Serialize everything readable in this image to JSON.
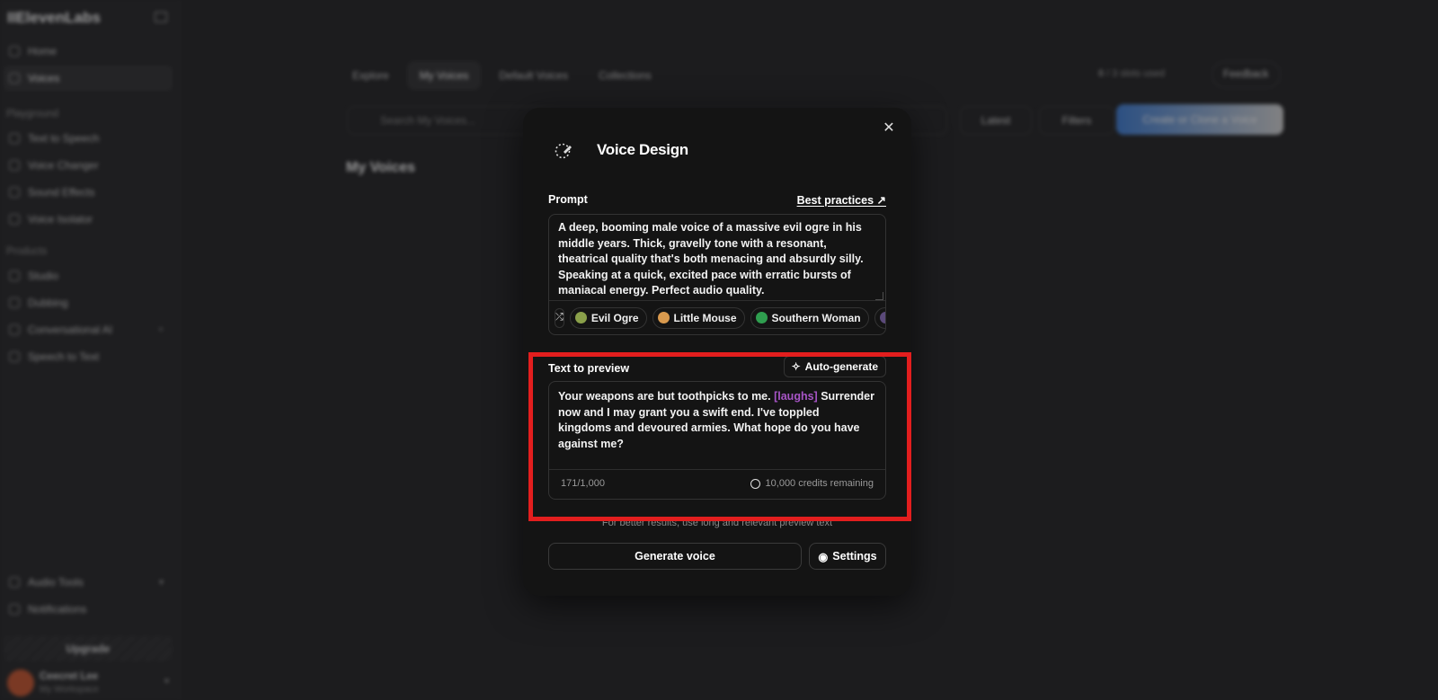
{
  "app": {
    "logo": "IIElevenLabs"
  },
  "sidebar": {
    "items": [
      {
        "label": "Home"
      },
      {
        "label": "Voices"
      },
      {
        "label": "Text to Speech"
      },
      {
        "label": "Voice Changer"
      },
      {
        "label": "Sound Effects"
      },
      {
        "label": "Voice Isolator"
      },
      {
        "label": "Studio"
      },
      {
        "label": "Dubbing"
      },
      {
        "label": "Conversational AI"
      },
      {
        "label": "Speech to Text"
      },
      {
        "label": "Audio Tools"
      },
      {
        "label": "Notifications"
      }
    ],
    "sections": {
      "playground": "Playground",
      "products": "Products"
    },
    "upgrade": "Upgrade",
    "user": {
      "name": "Ceecret Lee",
      "workspace": "My Workspace"
    }
  },
  "topnav": {
    "tabs": [
      "Explore",
      "My Voices",
      "Default Voices",
      "Collections"
    ],
    "slots_count": "0",
    "slots_text": "/ 3 slots used",
    "feedback": "Feedback"
  },
  "toolbar": {
    "search_placeholder": "Search My Voices...",
    "latest": "Latest",
    "filters": "Filters",
    "create": "Create or Clone a Voice"
  },
  "page": {
    "heading": "My Voices"
  },
  "modal": {
    "title": "Voice Design",
    "prompt_label": "Prompt",
    "best_practices": "Best practices ↗",
    "prompt_text": "A deep, booming male voice of a massive evil ogre in his middle years. Thick, gravelly tone with a resonant, theatrical quality that's both menacing and absurdly silly. Speaking at a quick, excited pace with erratic bursts of maniacal energy. Perfect audio quality.",
    "chips": [
      {
        "label": "Evil Ogre",
        "color": "#8aa04a"
      },
      {
        "label": "Little Mouse",
        "color": "#d99a4e"
      },
      {
        "label": "Southern Woman",
        "color": "#2f9e4f"
      }
    ],
    "preview_label": "Text to preview",
    "auto_generate": "Auto-generate",
    "preview_text_1": "Your weapons are but toothpicks to me.",
    "preview_tag": "[laughs]",
    "preview_text_2": "Surrender now and I may grant you a swift end. I've toppled kingdoms and devoured armies. What hope do you have against me?",
    "char_count": "171/1,000",
    "credits": "10,000 credits remaining",
    "hint": "For better results, use long and relevant preview text",
    "generate": "Generate voice",
    "settings": "Settings"
  }
}
